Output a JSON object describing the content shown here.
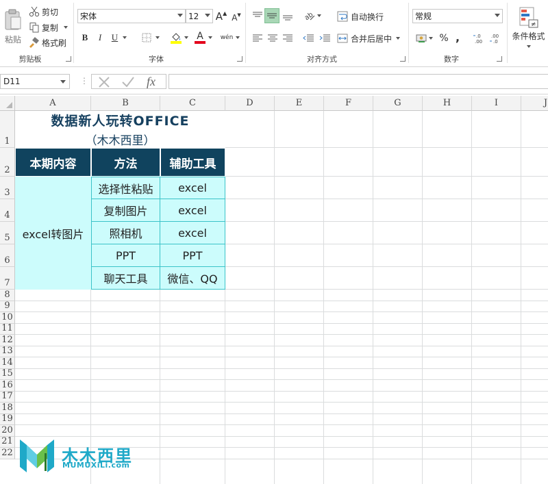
{
  "ribbon": {
    "clipboard": {
      "paste_label": "粘贴",
      "cut_label": "剪切",
      "copy_label": "复制",
      "format_painter_label": "格式刷",
      "group_label": "剪贴板"
    },
    "font": {
      "font_name": "宋体",
      "font_size": "12",
      "bold": "B",
      "italic": "I",
      "underline": "U",
      "grow": "A",
      "shrink": "A",
      "font_color_glyph": "A",
      "phonetic": "wén",
      "group_label": "字体",
      "highlight_color": "#ffff00",
      "font_color": "#e3001b"
    },
    "alignment": {
      "wrap_text_label": "自动换行",
      "merge_center_label": "合并后居中",
      "group_label": "对齐方式"
    },
    "number": {
      "format": "常规",
      "percent": "%",
      "comma": ",",
      "group_label": "数字"
    },
    "styles": {
      "conditional_format_label": "条件格式"
    }
  },
  "formula_bar": {
    "name_box": "D11",
    "formula": ""
  },
  "sheet": {
    "columns": [
      "A",
      "B",
      "C",
      "D",
      "E",
      "F",
      "G",
      "H",
      "I",
      "J"
    ],
    "rows": [
      "1",
      "2",
      "3",
      "4",
      "5",
      "6",
      "7",
      "8",
      "9",
      "10",
      "11",
      "12",
      "13",
      "14",
      "15",
      "16",
      "17",
      "18",
      "19",
      "20",
      "21",
      "22"
    ],
    "title": "数据新人玩转OFFICE",
    "subtitle": "（木木西里）",
    "table": {
      "headers": [
        "本期内容",
        "方法",
        "辅助工具"
      ],
      "merged_label": "excel转图片",
      "rows": [
        {
          "method": "选择性粘贴",
          "tool": "excel"
        },
        {
          "method": "复制图片",
          "tool": "excel"
        },
        {
          "method": "照相机",
          "tool": "excel"
        },
        {
          "method": "PPT",
          "tool": "PPT"
        },
        {
          "method": "聊天工具",
          "tool": "微信、QQ"
        }
      ],
      "header_bg": "#10435e",
      "cell_bg": "#ccfcfc",
      "border_color": "#3ac3c8"
    }
  },
  "watermark": {
    "name_cn": "木木西里",
    "name_en": "MUMUXiLi.com",
    "color": "#1fa9c8"
  }
}
